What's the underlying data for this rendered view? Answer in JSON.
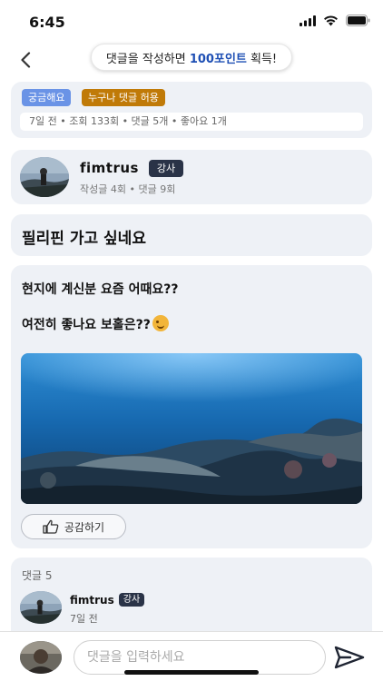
{
  "status_bar": {
    "time": "6:45"
  },
  "header": {
    "promo_prefix": "댓글을 작성하면 ",
    "promo_highlight": "100포인트",
    "promo_suffix": " 획득!"
  },
  "tags": [
    "궁금해요",
    "누구나 댓글 허용"
  ],
  "post_meta": "7일 전 • 조회 133회 • 댓글 5개 • 좋아요 1개",
  "author": {
    "name": "fimtrus",
    "badge": "강사",
    "stats": "작성글 4회 • 댓글 9회"
  },
  "post": {
    "title": "필리핀 가고 싶네요",
    "line1": "현지에 계신분 요즘 어때요??",
    "line2": "여전히 좋나요 보홀은??",
    "emoji": "winking-face",
    "like_label": "공감하기"
  },
  "comments": {
    "count_label": "댓글 5",
    "items": [
      {
        "name": "fimtrus",
        "badge": "강사",
        "time": "7일 전"
      }
    ]
  },
  "input": {
    "placeholder": "댓글을 입력하세요"
  },
  "colors": {
    "accent": "#1e4fb4",
    "card": "#eef1f6",
    "tag_blue": "#6a93e6",
    "tag_orange": "#c07a08",
    "badge": "#2a3347"
  }
}
